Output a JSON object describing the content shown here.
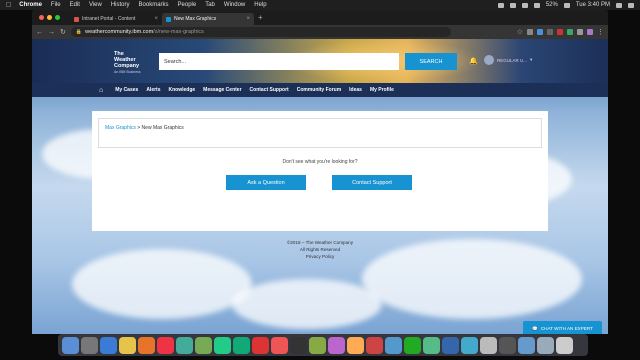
{
  "menubar": {
    "app": "Chrome",
    "items": [
      "File",
      "Edit",
      "View",
      "History",
      "Bookmarks",
      "People",
      "Tab",
      "Window",
      "Help"
    ],
    "battery": "52%",
    "clock": "Tue 3:40 PM"
  },
  "browser": {
    "tabs": [
      {
        "title": "Intranet Portal - Content",
        "favicon_color": "#d9534f"
      },
      {
        "title": "New Max Graphics",
        "favicon_color": "#1793d1"
      }
    ],
    "url_host": "weathercommunity.ibm.com",
    "url_path": "/s/new-max-graphics"
  },
  "site": {
    "logo_lines": [
      "The",
      "Weather",
      "Company"
    ],
    "logo_sub": "An IBM Business",
    "search_placeholder": "Search...",
    "search_button": "SEARCH",
    "user_name": "REGULAR U...",
    "nav": [
      "My Cases",
      "Alerts",
      "Knowledge",
      "Message Center",
      "Contact Support",
      "Community Forum",
      "Ideas",
      "My Profile"
    ],
    "breadcrumb_link": "Max Graphics",
    "breadcrumb_sep": " > ",
    "breadcrumb_current": "New Max Graphics",
    "prompt": "Don't see what you're looking for?",
    "ask_button": "Ask a Question",
    "contact_button": "Contact Support",
    "footer": [
      "©2018 – The Weather Company",
      "All Rights Reserved",
      "Privacy Policy"
    ],
    "chat_button": "CHAT WITH AN EXPERT"
  },
  "colors": {
    "accent": "#1793d1",
    "nav_bg": "#1b2f57"
  },
  "dock": {
    "icon_colors": [
      "#5a8fd6",
      "#777",
      "#3a7bd5",
      "#e6c34a",
      "#e8742c",
      "#e34",
      "#4a9",
      "#7a5",
      "#2c8",
      "#1a7",
      "#d33",
      "#e55",
      "#333",
      "#8a4",
      "#b6c",
      "#fa5",
      "#c44",
      "#59c",
      "#2a2",
      "#5b8",
      "#36a",
      "#4ac",
      "#bbb",
      "#555",
      "#69c",
      "#9ab",
      "#ccc"
    ]
  }
}
